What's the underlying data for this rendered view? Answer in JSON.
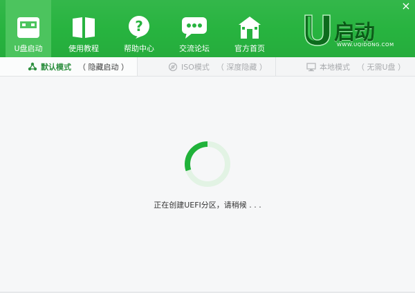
{
  "window": {
    "close_glyph": "×"
  },
  "nav": {
    "items": [
      {
        "label": "U盘启动",
        "icon": "usb-drive-icon",
        "active": true
      },
      {
        "label": "使用教程",
        "icon": "book-icon",
        "active": false
      },
      {
        "label": "帮助中心",
        "icon": "help-icon",
        "active": false
      },
      {
        "label": "交流论坛",
        "icon": "chat-icon",
        "active": false
      },
      {
        "label": "官方首页",
        "icon": "home-icon",
        "active": false
      }
    ]
  },
  "logo": {
    "brand": "启动",
    "url": "WWW.UQIDONG.COM"
  },
  "tabs": [
    {
      "name": "默认模式",
      "sub": "（ 隐藏启动 ）",
      "icon": "share-icon",
      "active": true
    },
    {
      "name": "ISO模式",
      "sub": "（ 深度隐藏 ）",
      "icon": "disc-icon",
      "active": false
    },
    {
      "name": "本地模式",
      "sub": "（ 无需U盘 ）",
      "icon": "monitor-icon",
      "active": false
    }
  ],
  "progress": {
    "fraction": 0.3
  },
  "status": {
    "text": "正在创建UEFI分区，请稍候 . . ."
  },
  "colors": {
    "header": "#27b33f",
    "active_nav": "#4cc45e",
    "accent": "#20b23a",
    "track": "#e2f3e4"
  }
}
